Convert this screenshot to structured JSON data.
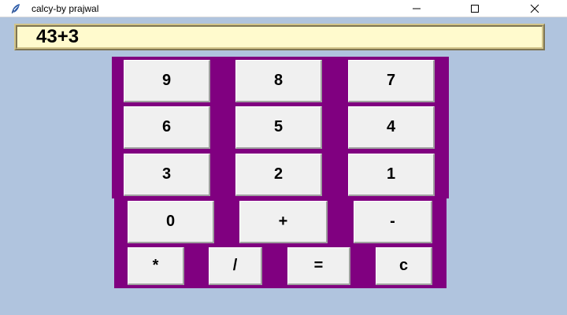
{
  "window": {
    "title": "calcy-by prajwal",
    "icon": "feather-icon",
    "controls": [
      "minimize-icon",
      "maximize-icon",
      "close-icon"
    ]
  },
  "display": {
    "value": "43+3"
  },
  "keypad": {
    "row1": [
      "9",
      "8",
      "7"
    ],
    "row2": [
      "6",
      "5",
      "4"
    ],
    "row3": [
      "3",
      "2",
      "1"
    ],
    "row4": [
      "0",
      "+",
      "-"
    ],
    "row5": [
      "*",
      "/",
      "=",
      "c"
    ]
  },
  "colors": {
    "background": "#b0c4de",
    "panel": "#800080",
    "display_bg": "#fffacd",
    "button": "#f0f0f0"
  }
}
